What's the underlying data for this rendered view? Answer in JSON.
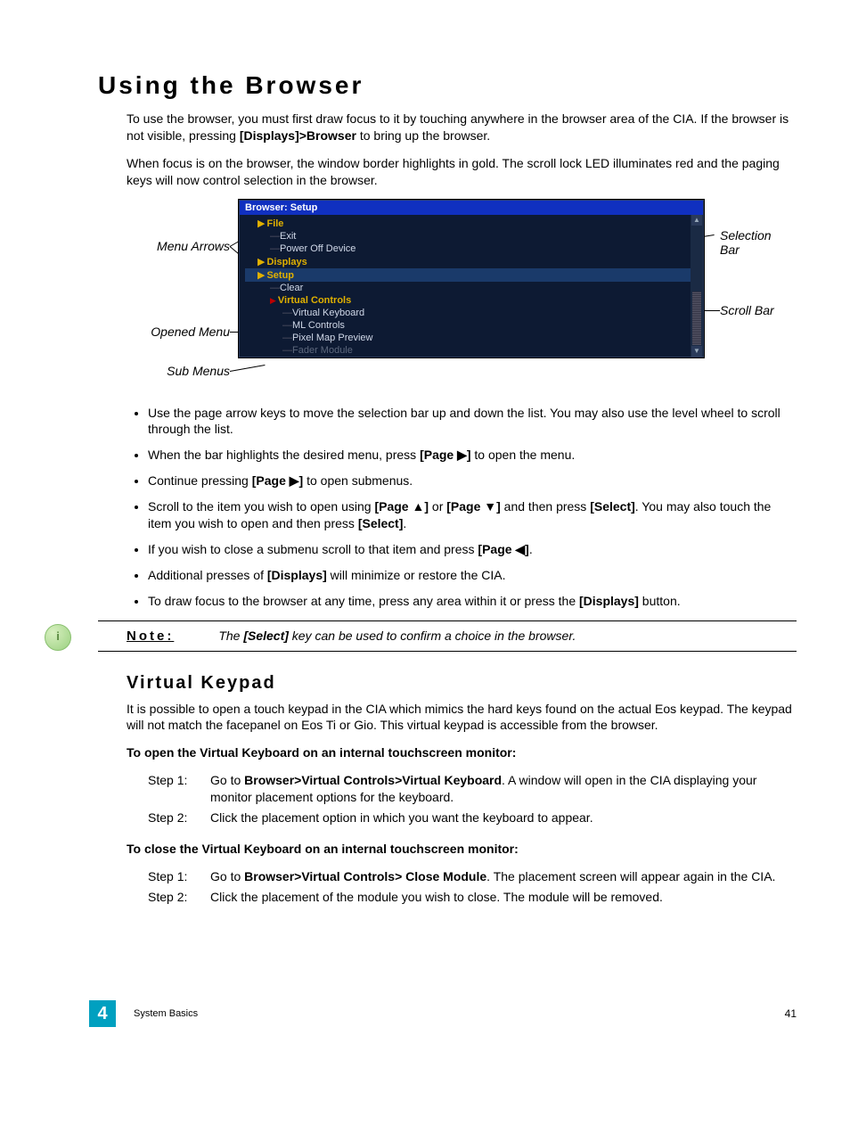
{
  "h1": "Using the Browser",
  "intro1_a": "To use the browser, you must first draw focus to it by touching anywhere in the browser area of the CIA. If the browser is not visible, pressing ",
  "intro1_b": "[Displays]>Browser",
  "intro1_c": " to bring up the browser.",
  "intro2": "When focus is on the browser, the window border highlights in gold. The scroll lock LED illuminates red and the paging keys will now control selection in the browser.",
  "callouts": {
    "menu_arrows": "Menu Arrows",
    "opened_menu": "Opened Menu",
    "sub_menus": "Sub Menus",
    "selection_bar_l1": "Selection",
    "selection_bar_l2": "Bar",
    "scroll_bar": "Scroll Bar"
  },
  "browser": {
    "title": "Browser: Setup",
    "items": [
      {
        "cls": "bi-indent1",
        "arrow": "gold",
        "text": "File",
        "bold": true
      },
      {
        "cls": "bi-indent2",
        "arrow": "line",
        "text": "Exit"
      },
      {
        "cls": "bi-indent2",
        "arrow": "line",
        "text": "Power Off Device"
      },
      {
        "cls": "bi-indent1",
        "arrow": "gold",
        "text": "Displays",
        "bold": true
      },
      {
        "cls": "bi-indent1 bi-sel",
        "arrow": "gold",
        "text": "Setup",
        "bold": true
      },
      {
        "cls": "bi-indent2",
        "arrow": "line",
        "text": "Clear"
      },
      {
        "cls": "bi-indent2",
        "arrow": "tick",
        "text": "Virtual Controls",
        "bold": true
      },
      {
        "cls": "bi-indent3",
        "arrow": "line",
        "text": "Virtual Keyboard"
      },
      {
        "cls": "bi-indent3",
        "arrow": "line",
        "text": "ML Controls"
      },
      {
        "cls": "bi-indent3",
        "arrow": "line",
        "text": "Pixel Map Preview"
      }
    ]
  },
  "bullets": {
    "b1": "Use the page arrow keys to move the selection bar up and down the list. You may also use the level wheel to scroll through the list.",
    "b2_a": "When the bar highlights the desired menu, press ",
    "b2_b": "[Page ▶]",
    "b2_c": " to open the menu.",
    "b3_a": "Continue pressing ",
    "b3_b": "[Page ▶]",
    "b3_c": " to open submenus.",
    "b4_a": "Scroll to the item you wish to open using ",
    "b4_b": "[Page ▲]",
    "b4_c": " or ",
    "b4_d": "[Page ▼]",
    "b4_e": " and then press ",
    "b4_f": "[Select]",
    "b4_g": ". You may also touch the item you wish to open and then press ",
    "b4_h": "[Select]",
    "b4_i": ".",
    "b5_a": "If you wish to close a submenu scroll to that item and press ",
    "b5_b": "[Page ◀]",
    "b5_c": ".",
    "b6_a": "Additional presses of ",
    "b6_b": "[Displays]",
    "b6_c": " will minimize or restore the CIA.",
    "b7_a": "To draw focus to the browser at any time, press any area within it or press the ",
    "b7_b": "[Displays]",
    "b7_c": " button."
  },
  "note": {
    "label": "Note:",
    "text_a": "The ",
    "text_b": "[Select]",
    "text_c": " key can be used to confirm a choice in the browser."
  },
  "h2": "Virtual Keypad",
  "vk_intro": "It is possible to open a touch keypad in the CIA which mimics the hard keys found on the actual Eos keypad. The keypad will not match the facepanel on Eos Ti or Gio. This virtual keypad is accessible from the browser.",
  "open_heading": "To open the Virtual Keyboard on an internal touchscreen monitor:",
  "open_s1_label": "Step 1:",
  "open_s1_a": "Go to ",
  "open_s1_b": "Browser>Virtual Controls>Virtual Keyboard",
  "open_s1_c": ". A window will open in the CIA displaying your monitor placement options for the keyboard.",
  "open_s2_label": "Step 2:",
  "open_s2": "Click the placement option in which you want the keyboard to appear.",
  "close_heading": "To close the Virtual Keyboard on an internal touchscreen monitor:",
  "close_s1_label": "Step 1:",
  "close_s1_a": "Go to ",
  "close_s1_b": "Browser>Virtual Controls> Close Module",
  "close_s1_c": ". The placement screen will appear again in the CIA.",
  "close_s2_label": "Step 2:",
  "close_s2": "Click the placement of the module you wish to close. The module will be removed.",
  "footer": {
    "chapnum": "4",
    "section": "System Basics",
    "page": "41"
  }
}
